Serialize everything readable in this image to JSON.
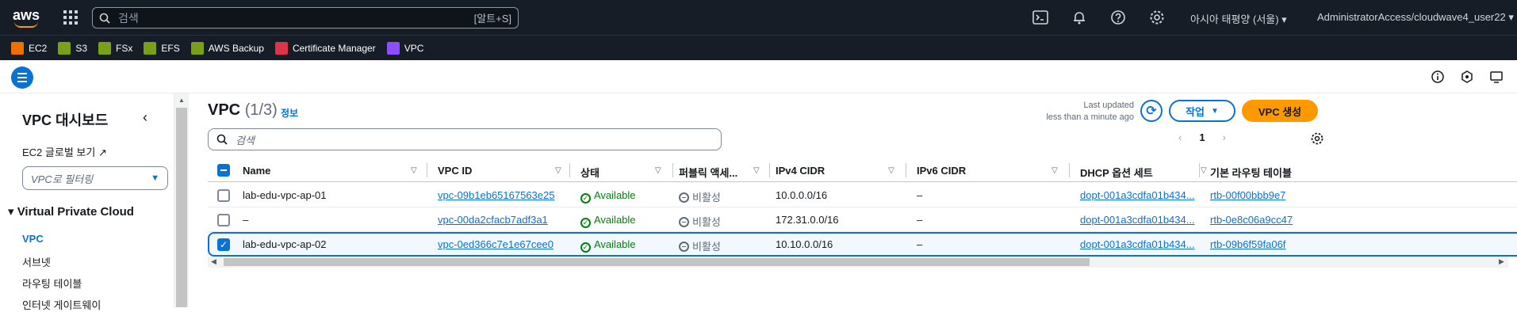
{
  "topbar": {
    "logo_text": "aws",
    "search_placeholder": "검색",
    "search_shortcut": "[알트+S]",
    "region": "아시아 태평양 (서울)",
    "account": "AdministratorAccess/cloudwave4_user22",
    "icons": [
      "cloudshell-icon",
      "bell-icon",
      "help-icon",
      "settings-icon"
    ]
  },
  "favorites": [
    {
      "label": "EC2",
      "color": "#ed7100"
    },
    {
      "label": "S3",
      "color": "#7aa116"
    },
    {
      "label": "FSx",
      "color": "#7aa116"
    },
    {
      "label": "EFS",
      "color": "#7aa116"
    },
    {
      "label": "AWS Backup",
      "color": "#7aa116"
    },
    {
      "label": "Certificate Manager",
      "color": "#dd344c"
    },
    {
      "label": "VPC",
      "color": "#8c4fff"
    }
  ],
  "sidebar": {
    "title": "VPC 대시보드",
    "global_view": "EC2 글로벌 보기",
    "filter_placeholder": "VPC로 필터링",
    "section": "Virtual Private Cloud",
    "items": [
      {
        "label": "VPC",
        "active": true
      },
      {
        "label": "서브넷",
        "active": false
      },
      {
        "label": "라우팅 테이블",
        "active": false
      },
      {
        "label": "인터넷 게이트웨이",
        "active": false
      }
    ]
  },
  "main": {
    "title": "VPC",
    "count": "(1/3)",
    "info": "정보",
    "last_updated_label": "Last updated",
    "last_updated_value": "less than a minute ago",
    "actions_label": "작업",
    "create_label": "VPC 생성",
    "search_placeholder": "검색",
    "page_number": "1",
    "columns": [
      "Name",
      "VPC ID",
      "상태",
      "퍼블릭 액세...",
      "IPv4 CIDR",
      "IPv6 CIDR",
      "DHCP 옵션 세트",
      "기본 라우팅 테이블"
    ],
    "rows": [
      {
        "name": "lab-edu-vpc-ap-01",
        "vpc_id": "vpc-09b1eb65167563e25",
        "state": "Available",
        "public_access": "비활성",
        "ipv4": "10.0.0.0/16",
        "ipv6": "–",
        "dhcp": "dopt-001a3cdfa01b434...",
        "route_table": "rtb-00f00bbb9e7",
        "selected": false
      },
      {
        "name": "–",
        "vpc_id": "vpc-00da2cfacb7adf3a1",
        "state": "Available",
        "public_access": "비활성",
        "ipv4": "172.31.0.0/16",
        "ipv6": "–",
        "dhcp": "dopt-001a3cdfa01b434...",
        "route_table": "rtb-0e8c06a9cc47",
        "selected": false
      },
      {
        "name": "lab-edu-vpc-ap-02",
        "vpc_id": "vpc-0ed366c7e1e67cee0",
        "state": "Available",
        "public_access": "비활성",
        "ipv4": "10.10.0.0/16",
        "ipv6": "–",
        "dhcp": "dopt-001a3cdfa01b434...",
        "route_table": "rtb-09b6f59fa06f",
        "selected": true
      }
    ]
  }
}
